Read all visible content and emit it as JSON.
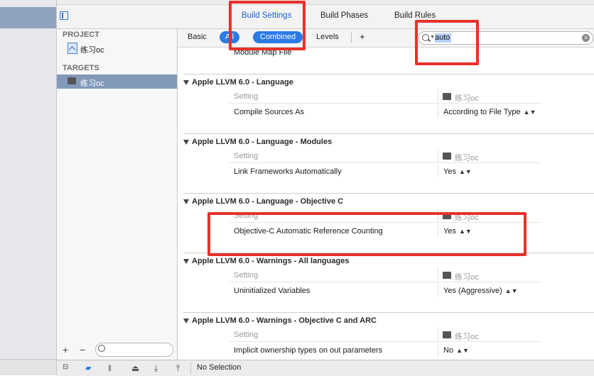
{
  "tabs": [
    {
      "label": "Build Settings",
      "active": true
    },
    {
      "label": "Build Phases",
      "active": false
    },
    {
      "label": "Build Rules",
      "active": false
    }
  ],
  "sidebar": {
    "project_header": "PROJECT",
    "project_item": "练习oc",
    "targets_header": "TARGETS",
    "target_item": "练习oc",
    "add_glyph": "+",
    "remove_glyph": "−"
  },
  "filterbar": {
    "basic": "Basic",
    "all": "All",
    "combined": "Combined",
    "levels": "Levels",
    "add": "+",
    "search_value": "auto",
    "clear_glyph": "×"
  },
  "content": {
    "partial_row": "Module Map File",
    "setting_label": "Setting",
    "target_label": "练习oc",
    "sections": [
      {
        "title": "Apple LLVM 6.0 - Language",
        "row": "Compile Sources As",
        "value": "According to File Type"
      },
      {
        "title": "Apple LLVM 6.0 - Language - Modules",
        "row": "Link Frameworks Automatically",
        "value": "Yes"
      },
      {
        "title": "Apple LLVM 6.0 - Language - Objective C",
        "row": "Objective-C Automatic Reference Counting",
        "value": "Yes"
      },
      {
        "title": "Apple LLVM 6.0 - Warnings - All languages",
        "row": "Uninitialized Variables",
        "value": "Yes (Aggressive)"
      },
      {
        "title": "Apple LLVM 6.0 - Warnings - Objective C and ARC",
        "row": "Implicit ownership types on out parameters",
        "value": "No"
      }
    ]
  },
  "bottombar": {
    "status": "No Selection"
  },
  "colors": {
    "accent": "#2b7be3",
    "highlight": "#e8312b",
    "selection": "#8299b9"
  }
}
